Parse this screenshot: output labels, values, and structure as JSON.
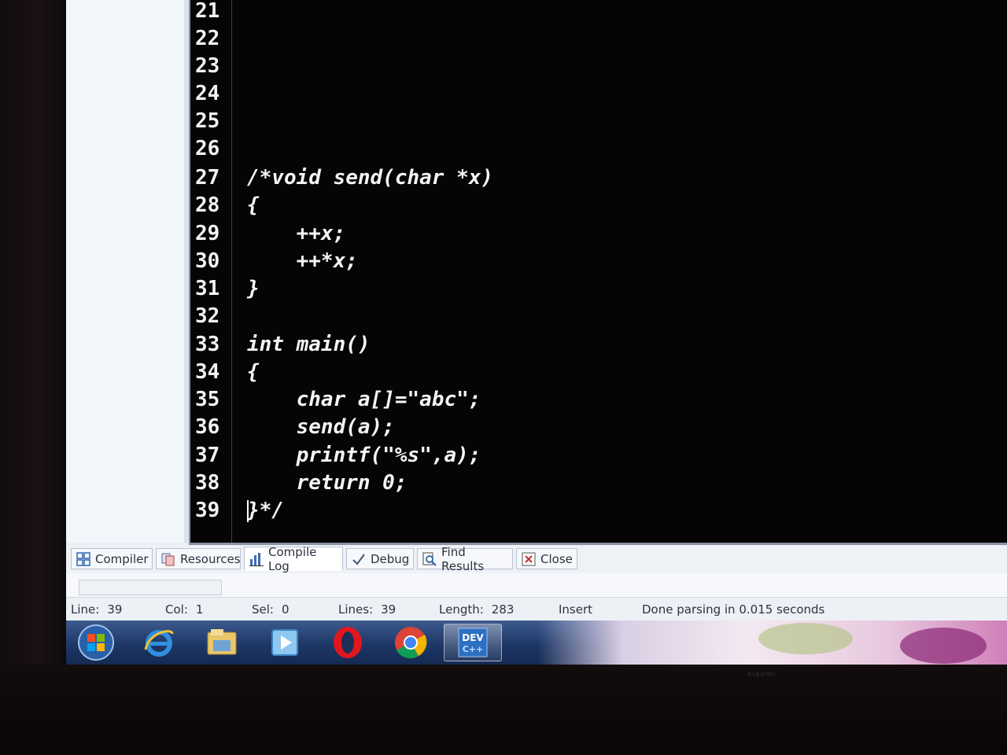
{
  "editor": {
    "lines": [
      {
        "num": "21",
        "code": ""
      },
      {
        "num": "22",
        "code": ""
      },
      {
        "num": "23",
        "code": ""
      },
      {
        "num": "24",
        "code": ""
      },
      {
        "num": "25",
        "code": ""
      },
      {
        "num": "26",
        "code": ""
      },
      {
        "num": "27",
        "code": "/*void send(char *x)"
      },
      {
        "num": "28",
        "code": "{"
      },
      {
        "num": "29",
        "code": "    ++x;"
      },
      {
        "num": "30",
        "code": "    ++*x;"
      },
      {
        "num": "31",
        "code": "}"
      },
      {
        "num": "32",
        "code": ""
      },
      {
        "num": "33",
        "code": "int main()"
      },
      {
        "num": "34",
        "code": "{"
      },
      {
        "num": "35",
        "code": "    char a[]=\"abc\";"
      },
      {
        "num": "36",
        "code": "    send(a);"
      },
      {
        "num": "37",
        "code": "    printf(\"%s\",a);"
      },
      {
        "num": "38",
        "code": "    return 0;"
      },
      {
        "num": "39",
        "code": "}*/"
      }
    ]
  },
  "tabs": [
    {
      "label": "Compiler",
      "icon": "compiler-grid-icon"
    },
    {
      "label": "Resources",
      "icon": "resources-icon"
    },
    {
      "label": "Compile Log",
      "icon": "bar-chart-icon"
    },
    {
      "label": "Debug",
      "icon": "checkmark-icon"
    },
    {
      "label": "Find Results",
      "icon": "magnifier-page-icon"
    },
    {
      "label": "Close",
      "icon": "close-panel-icon"
    }
  ],
  "status": {
    "line_label": "Line:",
    "line_value": "39",
    "col_label": "Col:",
    "col_value": "1",
    "sel_label": "Sel:",
    "sel_value": "0",
    "lines_label": "Lines:",
    "lines_value": "39",
    "length_label": "Length:",
    "length_value": "283",
    "mode": "Insert",
    "message": "Done parsing in 0.015 seconds"
  },
  "taskbar": {
    "items": [
      "start-orb-icon",
      "internet-explorer-icon",
      "file-explorer-icon",
      "media-player-icon",
      "opera-icon",
      "chrome-icon",
      "dev-cpp-icon"
    ],
    "devcpp_label_top": "DEV",
    "devcpp_label_bottom": "C++"
  },
  "monitor": {
    "brand": "xiaomi"
  },
  "colors": {
    "editor_bg": "#050507",
    "code_text": "#f4f4f4",
    "taskbar": "#1e3766"
  }
}
